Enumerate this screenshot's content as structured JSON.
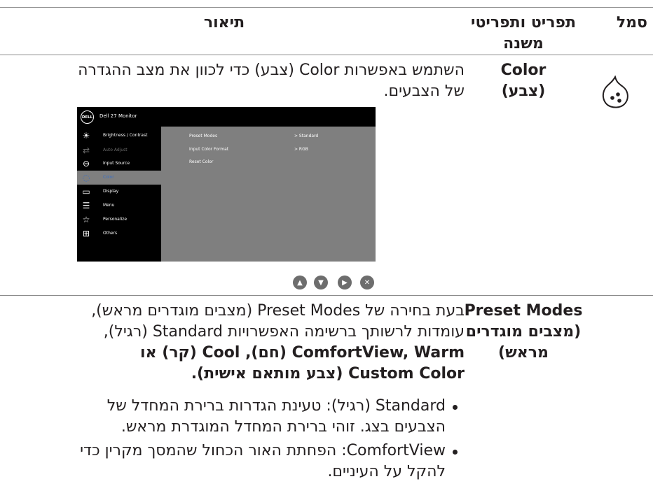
{
  "header": {
    "col_symbol": "סמל",
    "col_feature_line1": "תפריט ותפריטי",
    "col_feature_line2": "משנה",
    "col_description": "תיאור"
  },
  "row_color": {
    "feature_line1": "Color",
    "feature_line2": "(צבע)",
    "icon": "color-palette-icon",
    "desc_line1": "השתמש באפשרות Color (צבע) כדי לכוון את מצב ההגדרה",
    "desc_line2": "של הצבעים."
  },
  "osd": {
    "brand": "DELL",
    "monitor_title": "Dell 27 Monitor",
    "menu_items": [
      {
        "label": "Brightness / Contrast",
        "icon": "brightness-icon"
      },
      {
        "label": "Auto Adjust",
        "icon": "auto-adjust-icon"
      },
      {
        "label": "Input Source",
        "icon": "input-source-icon"
      },
      {
        "label": "Color",
        "icon": "color-icon"
      },
      {
        "label": "Display",
        "icon": "display-icon"
      },
      {
        "label": "Menu",
        "icon": "menu-icon"
      },
      {
        "label": "Personalize",
        "icon": "star-icon"
      },
      {
        "label": "Others",
        "icon": "others-icon"
      }
    ],
    "submenu": [
      {
        "label": "Preset Modes",
        "value": "> Standard"
      },
      {
        "label": "Input Color Format",
        "value": "> RGB"
      },
      {
        "label": "Reset Color",
        "value": ""
      }
    ]
  },
  "nav_buttons": [
    "up-icon",
    "down-icon",
    "right-icon",
    "close-icon"
  ],
  "row_preset": {
    "feature_line1": "Preset Modes",
    "feature_line2": "(מצבים מוגדרים",
    "feature_line3": "מראש)",
    "desc_line1": "בעת בחירה של Preset Modes (מצבים מוגדרים מראש),",
    "desc_line2": "עומדות לרשותך ברשימה האפשרויות Standard (רגיל),",
    "desc_line3": "ComfortView, Warm (חם), Cool (קר) או",
    "desc_line4": "Custom Color (צבע מותאם אישית).",
    "bullet1_line1": "Standard (רגיל): טעינת הגדרות ברירת המחדל של",
    "bullet1_line2": "הצבעים בצג. זוהי ברירת המחדל המוגדרת מראש.",
    "bullet2_line1": "ComfortView: הפחתת האור הכחול שהמסך מקרין כדי",
    "bullet2_line2": "להקל על העיניים."
  }
}
